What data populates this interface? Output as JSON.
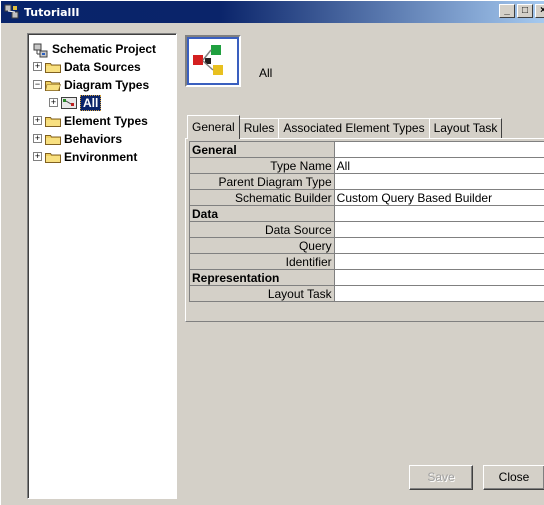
{
  "window": {
    "title": "TutorialII"
  },
  "title_buttons": {
    "minimize": "_",
    "maximize": "□",
    "close": "×"
  },
  "tree": {
    "root": {
      "label": "Schematic Project"
    },
    "items": [
      {
        "label": "Data Sources",
        "expander": "+"
      },
      {
        "label": "Diagram Types",
        "expander": "−"
      },
      {
        "label": "All",
        "expander": "+",
        "selected": true
      },
      {
        "label": "Element Types",
        "expander": "+"
      },
      {
        "label": "Behaviors",
        "expander": "+"
      },
      {
        "label": "Environment",
        "expander": "+"
      }
    ]
  },
  "header": {
    "name": "All"
  },
  "tabs": [
    {
      "label": "General"
    },
    {
      "label": "Rules"
    },
    {
      "label": "Associated Element Types"
    },
    {
      "label": "Layout Task"
    }
  ],
  "grid": {
    "sections": {
      "general": "General",
      "data": "Data",
      "representation": "Representation"
    },
    "rows": {
      "type_name": {
        "key": "Type Name",
        "value": "All"
      },
      "parent_diagram_type": {
        "key": "Parent Diagram Type",
        "value": ""
      },
      "schematic_builder": {
        "key": "Schematic Builder",
        "value": "Custom Query Based Builder"
      },
      "data_source": {
        "key": "Data Source",
        "value": ""
      },
      "query": {
        "key": "Query",
        "value": ""
      },
      "identifier": {
        "key": "Identifier",
        "value": ""
      },
      "layout_task": {
        "key": "Layout Task",
        "value": ""
      }
    }
  },
  "buttons": {
    "save": "Save",
    "close": "Close"
  },
  "colors": {
    "titlebar_start": "#0a246a",
    "titlebar_end": "#a6caf0",
    "selection": "#0a246a",
    "face": "#d4d0c8"
  }
}
